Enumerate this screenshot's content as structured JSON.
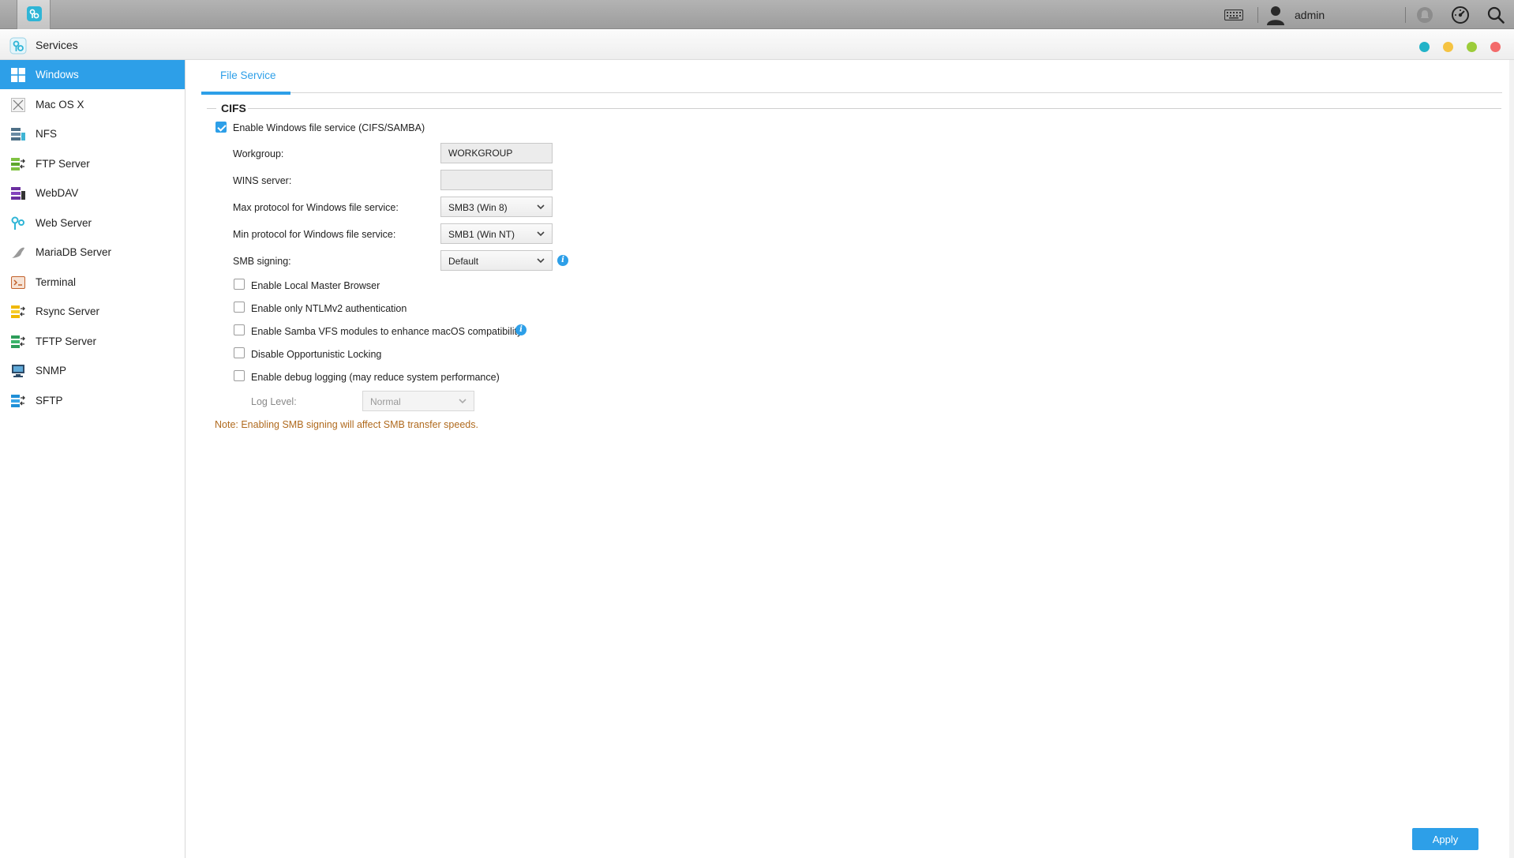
{
  "topbar": {
    "username": "admin"
  },
  "window": {
    "title": "Services",
    "controls": [
      {
        "name": "window-dot-teal",
        "color": "#22b3c8"
      },
      {
        "name": "window-dot-yellow",
        "color": "#f5c342"
      },
      {
        "name": "window-dot-green",
        "color": "#9ccc3a"
      },
      {
        "name": "window-dot-red",
        "color": "#f36a6a"
      }
    ]
  },
  "sidebar": {
    "items": [
      {
        "label": "Windows",
        "icon": "windows-icon",
        "active": true
      },
      {
        "label": "Mac OS X",
        "icon": "mac-os-icon"
      },
      {
        "label": "NFS",
        "icon": "nfs-icon"
      },
      {
        "label": "FTP Server",
        "icon": "ftp-server-icon"
      },
      {
        "label": "WebDAV",
        "icon": "webdav-icon"
      },
      {
        "label": "Web Server",
        "icon": "web-server-icon"
      },
      {
        "label": "MariaDB Server",
        "icon": "mariadb-icon"
      },
      {
        "label": "Terminal",
        "icon": "terminal-icon"
      },
      {
        "label": "Rsync Server",
        "icon": "rsync-server-icon"
      },
      {
        "label": "TFTP Server",
        "icon": "tftp-server-icon"
      },
      {
        "label": "SNMP",
        "icon": "snmp-icon"
      },
      {
        "label": "SFTP",
        "icon": "sftp-icon"
      }
    ]
  },
  "main": {
    "tabs": [
      {
        "label": "File Service",
        "active": true
      }
    ],
    "section_title": "CIFS",
    "enable_cifs": {
      "label": "Enable Windows file service (CIFS/SAMBA)",
      "checked": true
    },
    "fields": {
      "workgroup": {
        "label": "Workgroup:",
        "value": "WORKGROUP"
      },
      "wins": {
        "label": "WINS server:",
        "value": ""
      },
      "max_protocol": {
        "label": "Max protocol for Windows file service:",
        "value": "SMB3 (Win 8)"
      },
      "min_protocol": {
        "label": "Min protocol for Windows file service:",
        "value": "SMB1 (Win NT)"
      },
      "smb_signing": {
        "label": "SMB signing:",
        "value": "Default"
      }
    },
    "options": [
      {
        "label": "Enable Local Master Browser",
        "checked": false
      },
      {
        "label": "Enable only NTLMv2 authentication",
        "checked": false
      },
      {
        "label": "Enable Samba VFS modules to enhance macOS compatibility.",
        "checked": false,
        "info": true
      },
      {
        "label": "Disable Opportunistic Locking",
        "checked": false
      },
      {
        "label": "Enable debug logging (may reduce system performance)",
        "checked": false
      }
    ],
    "log_level": {
      "label": "Log Level:",
      "value": "Normal",
      "disabled": true
    },
    "note": "Note: Enabling SMB signing will affect SMB transfer speeds.",
    "apply_label": "Apply"
  },
  "colors": {
    "accent": "#2d9fe8",
    "note": "#b06a1e"
  }
}
